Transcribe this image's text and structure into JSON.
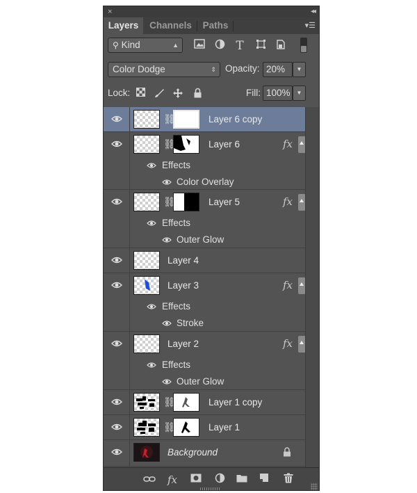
{
  "panel": {
    "close_glyph": "×",
    "collapse_glyph": "◂◂",
    "tabs": [
      {
        "label": "Layers",
        "active": true
      },
      {
        "label": "Channels",
        "active": false
      },
      {
        "label": "Paths",
        "active": false
      }
    ],
    "flyout_glyph": "▾☰"
  },
  "filter": {
    "kind_label": "Kind",
    "icons": [
      "image-filter-icon",
      "adjustment-filter-icon",
      "type-filter-icon",
      "shape-filter-icon",
      "smart-object-filter-icon",
      "filter-toggle-switch"
    ]
  },
  "blend": {
    "mode": "Color Dodge",
    "opacity_label": "Opacity:",
    "opacity_value": "20%"
  },
  "lock": {
    "label": "Lock:",
    "icons": [
      "lock-transparent-icon",
      "lock-image-icon",
      "lock-position-icon",
      "lock-all-icon"
    ],
    "fill_label": "Fill:",
    "fill_value": "100%"
  },
  "layers": [
    {
      "name": "Layer 6 copy",
      "selected": true,
      "mask": "white",
      "fx": false,
      "effects_label": "",
      "effects": []
    },
    {
      "name": "Layer 6",
      "selected": false,
      "mask": "figure",
      "fx": true,
      "effects_label": "Effects",
      "effects": [
        "Color Overlay"
      ]
    },
    {
      "name": "Layer 5",
      "selected": false,
      "mask": "split",
      "fx": true,
      "effects_label": "Effects",
      "effects": [
        "Outer Glow"
      ]
    },
    {
      "name": "Layer 4",
      "selected": false,
      "mask": "",
      "fx": false,
      "effects_label": "",
      "effects": []
    },
    {
      "name": "Layer 3",
      "selected": false,
      "mask": "",
      "thumb": "blue",
      "fx": true,
      "effects_label": "Effects",
      "effects": [
        "Stroke"
      ]
    },
    {
      "name": "Layer 2",
      "selected": false,
      "mask": "",
      "fx": true,
      "effects_label": "Effects",
      "effects": [
        "Outer Glow"
      ]
    },
    {
      "name": "Layer 1 copy",
      "selected": false,
      "mask": "dancer",
      "thumb": "pattern",
      "fx": false,
      "effects_label": "",
      "effects": []
    },
    {
      "name": "Layer 1",
      "selected": false,
      "mask": "dancer",
      "thumb": "pattern",
      "fx": false,
      "effects_label": "",
      "effects": []
    },
    {
      "name": "Background",
      "selected": false,
      "mask": "",
      "thumb": "photo",
      "fx": false,
      "locked": true,
      "effects_label": "",
      "effects": []
    }
  ],
  "fx_glyph": "fx",
  "bottom_bar": {
    "icons": [
      "link-layers-icon",
      "add-style-icon",
      "add-mask-icon",
      "new-adjustment-icon",
      "new-group-icon",
      "new-layer-icon",
      "delete-layer-icon"
    ]
  },
  "colors": {
    "selection": "#6d7c99",
    "panel": "#535353"
  }
}
